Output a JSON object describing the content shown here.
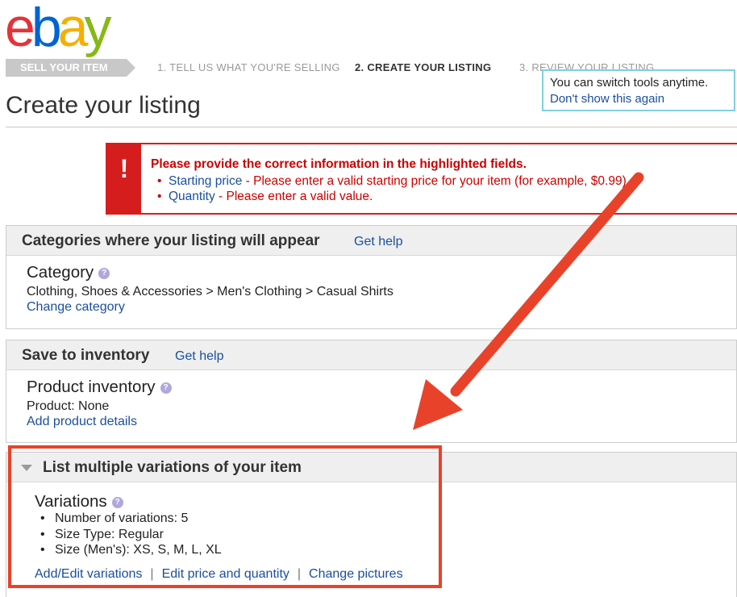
{
  "logo": {
    "e": "e",
    "b": "b",
    "a": "a",
    "y": "y"
  },
  "steps": {
    "sell": "SELL YOUR ITEM",
    "step1": "1. TELL US WHAT YOU'RE SELLING",
    "step2": "2. CREATE YOUR LISTING",
    "step3": "3. REVIEW YOUR LISTING"
  },
  "tooltip": {
    "message": "You can switch tools anytime.",
    "dismiss_link": "Don't show this again"
  },
  "page_title": "Create your listing",
  "error": {
    "icon": "!",
    "title": "Please provide the correct information in the highlighted fields.",
    "items": [
      {
        "bullet": "•",
        "field": "Starting price",
        "message": " - Please enter a valid starting price for your item (for example, $0.99)."
      },
      {
        "bullet": "•",
        "field": "Quantity",
        "message": " - Please enter a valid value."
      }
    ]
  },
  "categories": {
    "heading": "Categories where your listing will appear",
    "help": "Get help",
    "label": "Category",
    "help_icon": "?",
    "path": "Clothing, Shoes & Accessories > Men's Clothing > Casual Shirts",
    "change_link": "Change category"
  },
  "inventory": {
    "heading": "Save to inventory",
    "help": "Get help",
    "label": "Product inventory",
    "help_icon": "?",
    "product": "Product: None",
    "add_link": "Add product details"
  },
  "variations": {
    "heading": "List multiple variations of your item",
    "label": "Variations",
    "help_icon": "?",
    "details": [
      {
        "bullet": "•",
        "text": "Number of variations: 5"
      },
      {
        "bullet": "•",
        "text": "Size Type: Regular"
      },
      {
        "bullet": "•",
        "text": "Size (Men's): XS, S, M, L, XL"
      }
    ],
    "actions": [
      "Add/Edit variations",
      "Edit price and quantity",
      "Change pictures"
    ],
    "separator": "|"
  },
  "colors": {
    "error_red": "#d61d1d",
    "link_blue": "#1a4fa0",
    "annotation_orange": "#e8432a",
    "tooltip_border": "#7ed0e0"
  }
}
